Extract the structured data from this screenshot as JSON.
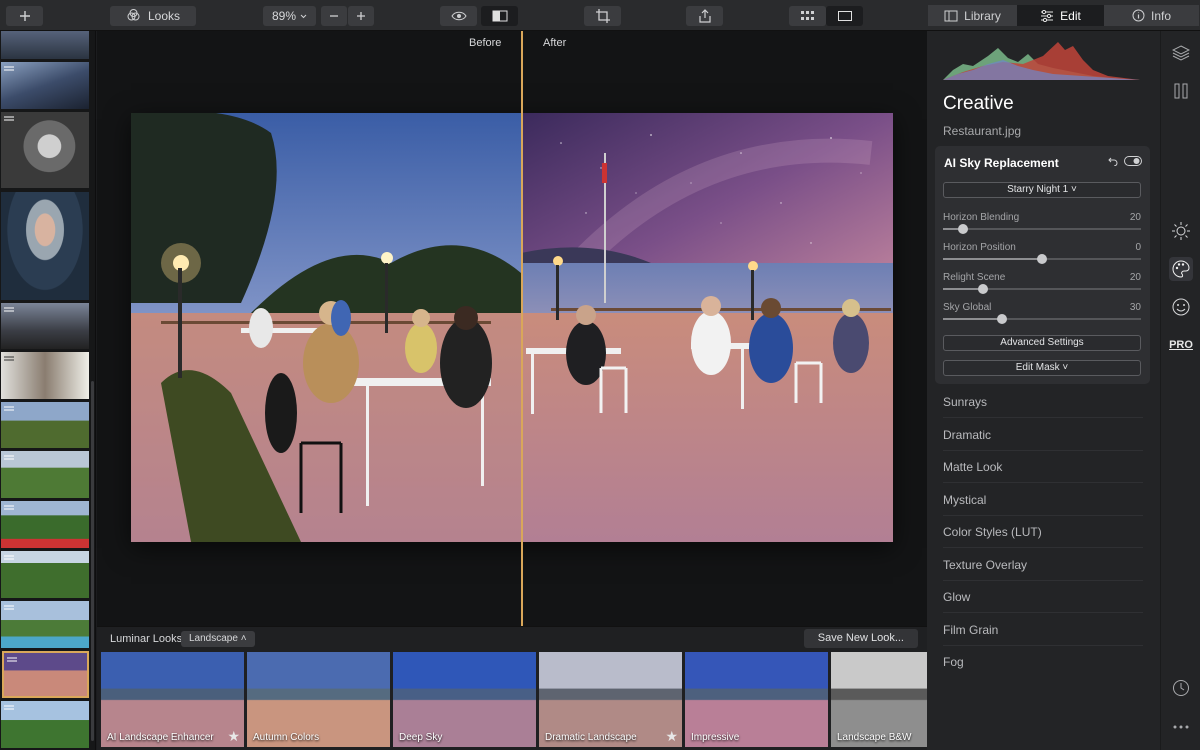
{
  "toolbar": {
    "add_icon": "plus-icon",
    "looks_label": "Looks",
    "zoom": "89%",
    "tabs": [
      {
        "label": "Library",
        "icon": "library-icon"
      },
      {
        "label": "Edit",
        "icon": "sliders-icon"
      },
      {
        "label": "Info",
        "icon": "info-icon"
      }
    ],
    "active_tab": "Edit"
  },
  "canvas": {
    "before_label": "Before",
    "after_label": "After"
  },
  "looks": {
    "label": "Luminar Looks:",
    "category": "Landscape",
    "save_label": "Save New Look...",
    "items": [
      {
        "name": "AI Landscape Enhancer",
        "starred": true
      },
      {
        "name": "Autumn Colors",
        "starred": false
      },
      {
        "name": "Deep Sky",
        "starred": false
      },
      {
        "name": "Dramatic Landscape",
        "starred": true
      },
      {
        "name": "Impressive",
        "starred": false
      },
      {
        "name": "Landscape B&W",
        "starred": false
      }
    ]
  },
  "panel": {
    "title": "Creative",
    "file_name": "Restaurant.jpg",
    "tool": {
      "title": "AI Sky Replacement",
      "sky_select": "Starry Night 1",
      "sliders": [
        {
          "label": "Horizon Blending",
          "value": "20",
          "fraction": 0.1
        },
        {
          "label": "Horizon Position",
          "value": "0",
          "fraction": 0.5
        },
        {
          "label": "Relight Scene",
          "value": "20",
          "fraction": 0.2
        },
        {
          "label": "Sky Global",
          "value": "30",
          "fraction": 0.3
        }
      ],
      "advanced_label": "Advanced Settings",
      "mask_label": "Edit Mask"
    },
    "other_tools": [
      "Sunrays",
      "Dramatic",
      "Matte Look",
      "Mystical",
      "Color Styles (LUT)",
      "Texture Overlay",
      "Glow",
      "Film Grain",
      "Fog"
    ]
  },
  "rail": {
    "pro_label": "PRO"
  },
  "colors": {
    "accent_divider": "#d9a75a",
    "panel_bg": "#232426"
  }
}
